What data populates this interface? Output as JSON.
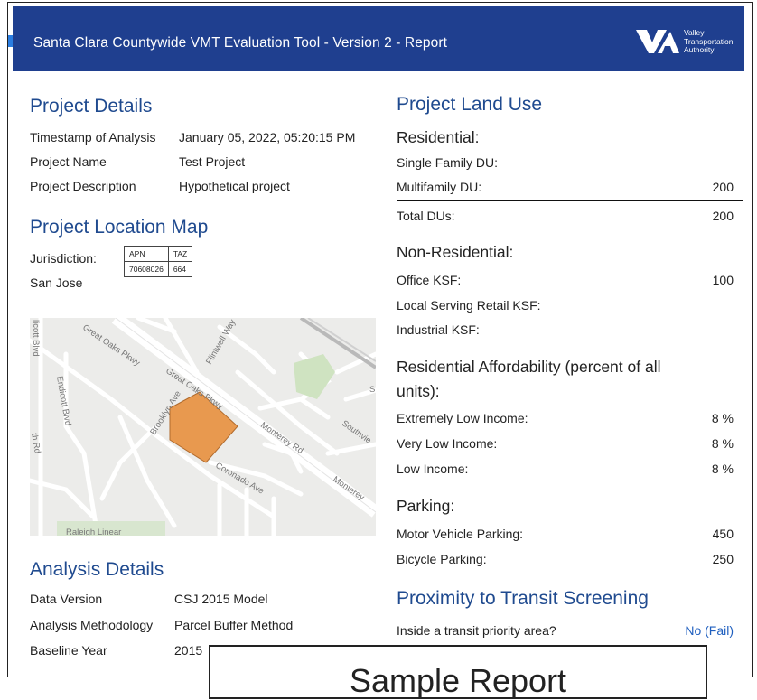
{
  "header": {
    "title": "Santa Clara Countywide VMT Evaluation Tool - Version 2 - Report",
    "logo_text": [
      "Valley",
      "Transportation",
      "Authority"
    ]
  },
  "project_details": {
    "heading": "Project Details",
    "rows": [
      {
        "label": "Timestamp of Analysis",
        "value": "January 05, 2022, 05:20:15 PM"
      },
      {
        "label": "Project Name",
        "value": "Test Project"
      },
      {
        "label": "Project Description",
        "value": "Hypothetical project"
      }
    ]
  },
  "location": {
    "heading": "Project Location Map",
    "jurisdiction_label": "Jurisdiction:",
    "jurisdiction_value": "San Jose",
    "table": {
      "headers": [
        "APN",
        "TAZ"
      ],
      "values": [
        "70608026",
        "664"
      ]
    }
  },
  "map": {
    "street_labels": [
      "Great Oaks Pkwy",
      "Great Oaks Pkwy",
      "Flintwell Way",
      "Brooklyn Ave",
      "Monterey Rd",
      "Monterey",
      "Coronado Ave",
      "Endicott Blvd",
      "Southvie",
      "Raleigh Linear",
      "licott Blvd",
      "Si",
      "th Rd"
    ],
    "colors": {
      "parcel": "#e8994f",
      "road": "#ffffff",
      "land": "#ececea",
      "park": "#cfe3c1",
      "rail": "#b9b9b9"
    }
  },
  "analysis": {
    "heading": "Analysis Details",
    "rows": [
      {
        "label": "Data Version",
        "value": "CSJ 2015 Model"
      },
      {
        "label": "Analysis Methodology",
        "value": "Parcel Buffer Method"
      },
      {
        "label": "Baseline Year",
        "value": "2015"
      }
    ]
  },
  "land_use": {
    "heading": "Project Land Use",
    "residential": {
      "heading": "Residential:",
      "single_family_label": "Single Family DU:",
      "single_family_value": "",
      "multifamily_label": "Multifamily DU:",
      "multifamily_value": "200",
      "total_label": "Total DUs:",
      "total_value": "200"
    },
    "non_residential": {
      "heading": "Non-Residential:",
      "office_label": "Office KSF:",
      "office_value": "100",
      "retail_label": "Local Serving Retail KSF:",
      "retail_value": "",
      "industrial_label": "Industrial KSF:",
      "industrial_value": ""
    },
    "affordability": {
      "heading_line1": "Residential Affordability (percent of all",
      "heading_line2": "units):",
      "rows": [
        {
          "label": "Extremely Low Income:",
          "value": "8 %"
        },
        {
          "label": "Very Low Income:",
          "value": "8 %"
        },
        {
          "label": "Low Income:",
          "value": "8 %"
        }
      ]
    },
    "parking": {
      "heading": "Parking:",
      "motor_label": "Motor Vehicle Parking:",
      "motor_value": "450",
      "bike_label": "Bicycle Parking:",
      "bike_value": "250"
    }
  },
  "transit": {
    "heading": "Proximity to Transit Screening",
    "question": "Inside a transit priority area?",
    "answer": "No (Fail)"
  },
  "overlay": {
    "text": "Sample Report"
  }
}
